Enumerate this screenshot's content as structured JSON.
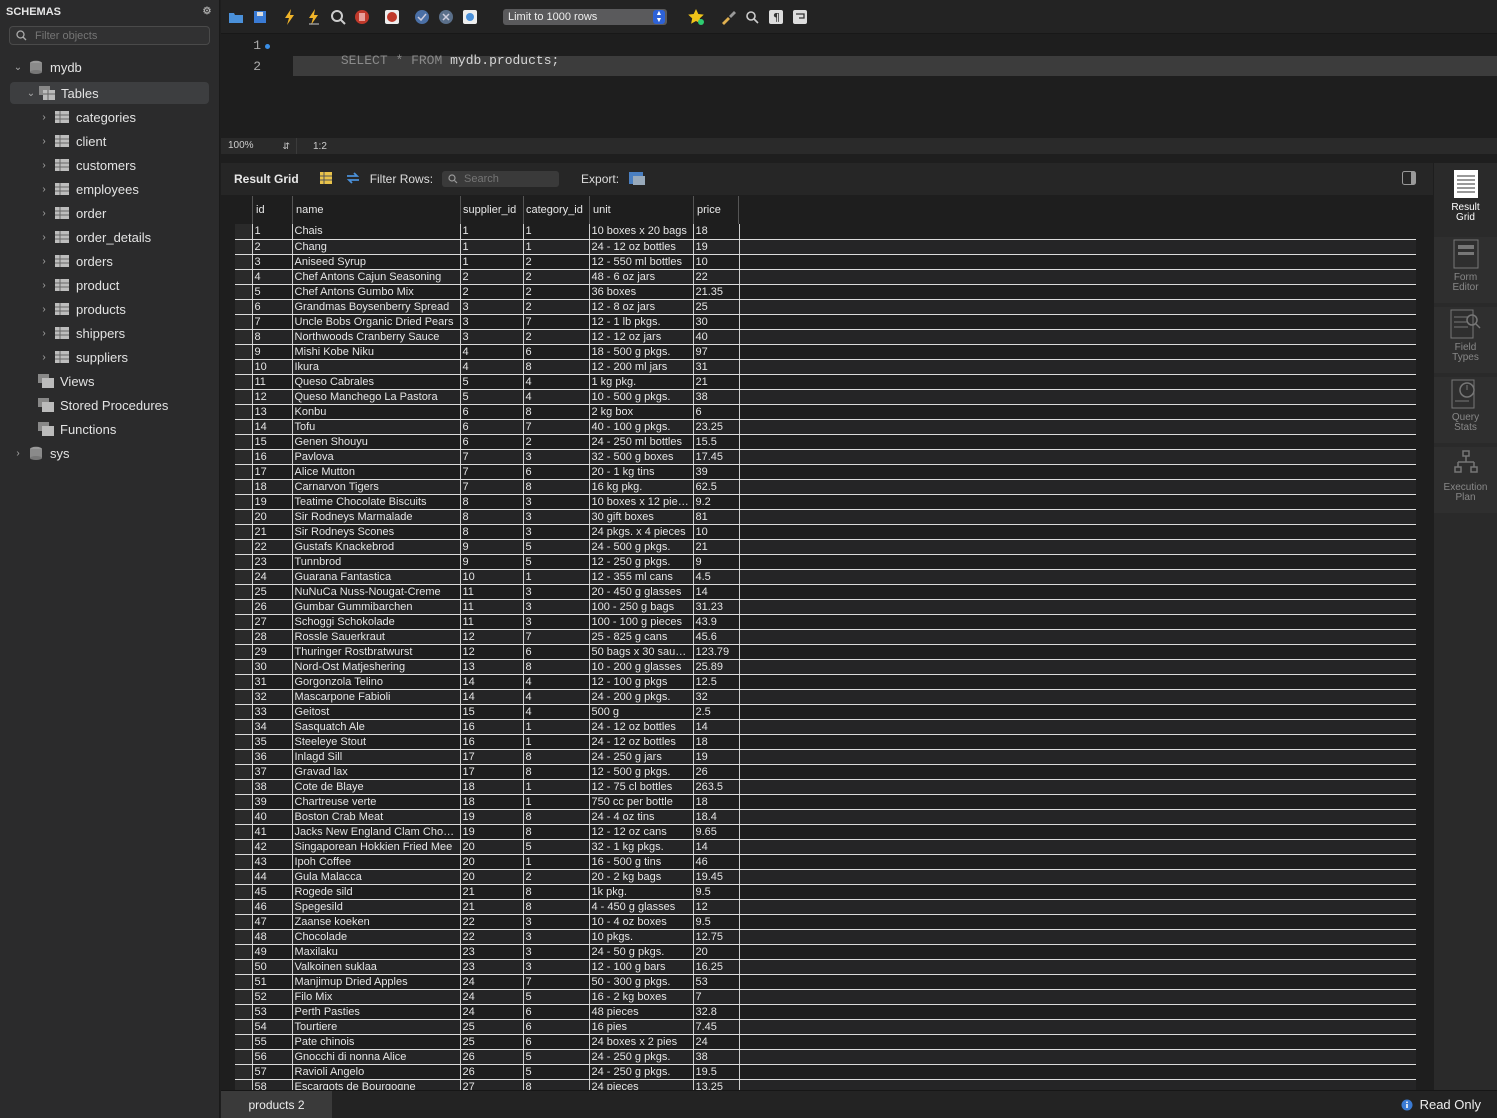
{
  "sidebar": {
    "title": "SCHEMAS",
    "filter_placeholder": "Filter objects",
    "db1": "mydb",
    "tables_label": "Tables",
    "tables": [
      "categories",
      "client",
      "customers",
      "employees",
      "order",
      "order_details",
      "orders",
      "product",
      "products",
      "shippers",
      "suppliers"
    ],
    "views": "Views",
    "procs": "Stored Procedures",
    "funcs": "Functions",
    "db2": "sys"
  },
  "toolbar": {
    "limit": "Limit to 1000 rows"
  },
  "editor": {
    "line1_num": "1",
    "line2_num": "2",
    "kw_select": "SELECT",
    "star": "*",
    "kw_from": "FROM",
    "table_ref": "mydb.products;"
  },
  "editor_status": {
    "zoom": "100%",
    "position": "1:2"
  },
  "result_toolbar": {
    "result_grid": "Result Grid",
    "filter_rows": "Filter Rows:",
    "search_placeholder": "Search",
    "export": "Export:"
  },
  "grid": {
    "columns": [
      "id",
      "name",
      "supplier_id",
      "category_id",
      "unit",
      "price"
    ],
    "rows": [
      [
        "1",
        "Chais",
        "1",
        "1",
        "10 boxes x 20 bags",
        "18"
      ],
      [
        "2",
        "Chang",
        "1",
        "1",
        "24 - 12 oz bottles",
        "19"
      ],
      [
        "3",
        "Aniseed Syrup",
        "1",
        "2",
        "12 - 550 ml bottles",
        "10"
      ],
      [
        "4",
        "Chef Antons Cajun Seasoning",
        "2",
        "2",
        "48 - 6 oz jars",
        "22"
      ],
      [
        "5",
        "Chef Antons Gumbo Mix",
        "2",
        "2",
        "36 boxes",
        "21.35"
      ],
      [
        "6",
        "Grandmas Boysenberry Spread",
        "3",
        "2",
        "12 - 8 oz jars",
        "25"
      ],
      [
        "7",
        "Uncle Bobs Organic Dried Pears",
        "3",
        "7",
        "12 - 1 lb pkgs.",
        "30"
      ],
      [
        "8",
        "Northwoods Cranberry Sauce",
        "3",
        "2",
        "12 - 12 oz jars",
        "40"
      ],
      [
        "9",
        "Mishi Kobe Niku",
        "4",
        "6",
        "18 - 500 g pkgs.",
        "97"
      ],
      [
        "10",
        "Ikura",
        "4",
        "8",
        "12 - 200 ml jars",
        "31"
      ],
      [
        "11",
        "Queso Cabrales",
        "5",
        "4",
        "1 kg pkg.",
        "21"
      ],
      [
        "12",
        "Queso Manchego La Pastora",
        "5",
        "4",
        "10 - 500 g pkgs.",
        "38"
      ],
      [
        "13",
        "Konbu",
        "6",
        "8",
        "2 kg box",
        "6"
      ],
      [
        "14",
        "Tofu",
        "6",
        "7",
        "40 - 100 g pkgs.",
        "23.25"
      ],
      [
        "15",
        "Genen Shouyu",
        "6",
        "2",
        "24 - 250 ml bottles",
        "15.5"
      ],
      [
        "16",
        "Pavlova",
        "7",
        "3",
        "32 - 500 g boxes",
        "17.45"
      ],
      [
        "17",
        "Alice Mutton",
        "7",
        "6",
        "20 - 1 kg tins",
        "39"
      ],
      [
        "18",
        "Carnarvon Tigers",
        "7",
        "8",
        "16 kg pkg.",
        "62.5"
      ],
      [
        "19",
        "Teatime Chocolate Biscuits",
        "8",
        "3",
        "10 boxes x 12 pie…",
        "9.2"
      ],
      [
        "20",
        "Sir Rodneys Marmalade",
        "8",
        "3",
        "30 gift boxes",
        "81"
      ],
      [
        "21",
        "Sir Rodneys Scones",
        "8",
        "3",
        "24 pkgs. x 4 pieces",
        "10"
      ],
      [
        "22",
        "Gustafs Knackebrod",
        "9",
        "5",
        "24 - 500 g pkgs.",
        "21"
      ],
      [
        "23",
        "Tunnbrod",
        "9",
        "5",
        "12 - 250 g pkgs.",
        "9"
      ],
      [
        "24",
        "Guarana Fantastica",
        "10",
        "1",
        "12 - 355 ml cans",
        "4.5"
      ],
      [
        "25",
        "NuNuCa Nuss-Nougat-Creme",
        "11",
        "3",
        "20 - 450 g glasses",
        "14"
      ],
      [
        "26",
        "Gumbar Gummibarchen",
        "11",
        "3",
        "100 - 250 g bags",
        "31.23"
      ],
      [
        "27",
        "Schoggi Schokolade",
        "11",
        "3",
        "100 - 100 g pieces",
        "43.9"
      ],
      [
        "28",
        "Rossle Sauerkraut",
        "12",
        "7",
        "25 - 825 g cans",
        "45.6"
      ],
      [
        "29",
        "Thuringer Rostbratwurst",
        "12",
        "6",
        "50 bags x 30 saus…",
        "123.79"
      ],
      [
        "30",
        "Nord-Ost Matjeshering",
        "13",
        "8",
        "10 - 200 g glasses",
        "25.89"
      ],
      [
        "31",
        "Gorgonzola Telino",
        "14",
        "4",
        "12 - 100 g pkgs",
        "12.5"
      ],
      [
        "32",
        "Mascarpone Fabioli",
        "14",
        "4",
        "24 - 200 g pkgs.",
        "32"
      ],
      [
        "33",
        "Geitost",
        "15",
        "4",
        "500 g",
        "2.5"
      ],
      [
        "34",
        "Sasquatch Ale",
        "16",
        "1",
        "24 - 12 oz bottles",
        "14"
      ],
      [
        "35",
        "Steeleye Stout",
        "16",
        "1",
        "24 - 12 oz bottles",
        "18"
      ],
      [
        "36",
        "Inlagd Sill",
        "17",
        "8",
        "24 - 250 g jars",
        "19"
      ],
      [
        "37",
        "Gravad lax",
        "17",
        "8",
        "12 - 500 g pkgs.",
        "26"
      ],
      [
        "38",
        "Cote de Blaye",
        "18",
        "1",
        "12 - 75 cl bottles",
        "263.5"
      ],
      [
        "39",
        "Chartreuse verte",
        "18",
        "1",
        "750 cc per bottle",
        "18"
      ],
      [
        "40",
        "Boston Crab Meat",
        "19",
        "8",
        "24 - 4 oz tins",
        "18.4"
      ],
      [
        "41",
        "Jacks New England Clam Cho…",
        "19",
        "8",
        "12 - 12 oz cans",
        "9.65"
      ],
      [
        "42",
        "Singaporean Hokkien Fried Mee",
        "20",
        "5",
        "32 - 1 kg pkgs.",
        "14"
      ],
      [
        "43",
        "Ipoh Coffee",
        "20",
        "1",
        "16 - 500 g tins",
        "46"
      ],
      [
        "44",
        "Gula Malacca",
        "20",
        "2",
        "20 - 2 kg bags",
        "19.45"
      ],
      [
        "45",
        "Rogede sild",
        "21",
        "8",
        "1k pkg.",
        "9.5"
      ],
      [
        "46",
        "Spegesild",
        "21",
        "8",
        "4 - 450 g glasses",
        "12"
      ],
      [
        "47",
        "Zaanse koeken",
        "22",
        "3",
        "10 - 4 oz boxes",
        "9.5"
      ],
      [
        "48",
        "Chocolade",
        "22",
        "3",
        "10 pkgs.",
        "12.75"
      ],
      [
        "49",
        "Maxilaku",
        "23",
        "3",
        "24 - 50 g pkgs.",
        "20"
      ],
      [
        "50",
        "Valkoinen suklaa",
        "23",
        "3",
        "12 - 100 g bars",
        "16.25"
      ],
      [
        "51",
        "Manjimup Dried Apples",
        "24",
        "7",
        "50 - 300 g pkgs.",
        "53"
      ],
      [
        "52",
        "Filo Mix",
        "24",
        "5",
        "16 - 2 kg boxes",
        "7"
      ],
      [
        "53",
        "Perth Pasties",
        "24",
        "6",
        "48 pieces",
        "32.8"
      ],
      [
        "54",
        "Tourtiere",
        "25",
        "6",
        "16 pies",
        "7.45"
      ],
      [
        "55",
        "Pate chinois",
        "25",
        "6",
        "24 boxes x 2 pies",
        "24"
      ],
      [
        "56",
        "Gnocchi di nonna Alice",
        "26",
        "5",
        "24 - 250 g pkgs.",
        "38"
      ],
      [
        "57",
        "Ravioli Angelo",
        "26",
        "5",
        "24 - 250 g pkgs.",
        "19.5"
      ],
      [
        "58",
        "Escargots de Bourgogne",
        "27",
        "8",
        "24 pieces",
        "13.25"
      ]
    ]
  },
  "right_panel": {
    "result_grid": [
      "Result",
      "Grid"
    ],
    "form_editor": [
      "Form",
      "Editor"
    ],
    "field_types": [
      "Field",
      "Types"
    ],
    "query_stats": [
      "Query",
      "Stats"
    ],
    "execution_plan": [
      "Execution",
      "Plan"
    ]
  },
  "bottom": {
    "tab": "products 2",
    "read_only": "Read Only"
  }
}
